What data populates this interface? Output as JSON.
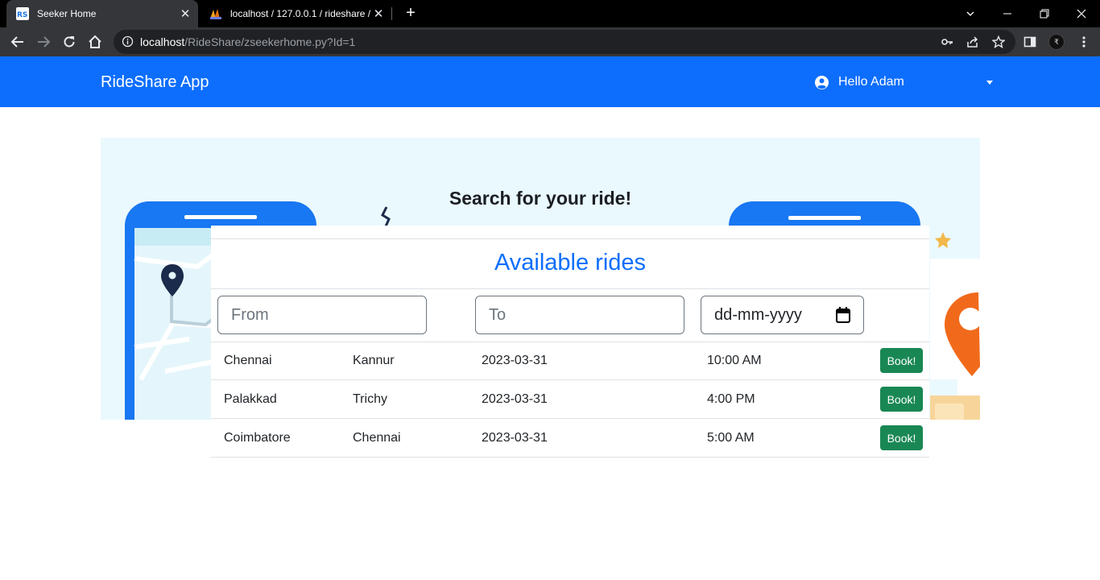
{
  "browser": {
    "tabs": [
      {
        "title": "Seeker Home",
        "favicon": "RS"
      },
      {
        "title": "localhost / 127.0.0.1 / rideshare /",
        "favicon": "phpmyadmin-icon"
      }
    ],
    "url_host": "localhost",
    "url_path": "/RideShare/zseekerhome.py?Id=1"
  },
  "navbar": {
    "brand": "RideShare App",
    "user_greeting": "Hello Adam"
  },
  "hero": {
    "title": "Search for your ride!"
  },
  "rides": {
    "title": "Available rides",
    "from_placeholder": "From",
    "to_placeholder": "To",
    "date_placeholder": "dd-mm-yyyy",
    "book_label": "Book!",
    "rows": [
      {
        "from": "Chennai",
        "to": "Kannur",
        "date": "2023-03-31",
        "time": "10:00 AM"
      },
      {
        "from": "Palakkad",
        "to": "Trichy",
        "date": "2023-03-31",
        "time": "4:00 PM"
      },
      {
        "from": "Coimbatore",
        "to": "Chennai",
        "date": "2023-03-31",
        "time": "5:00 AM"
      }
    ]
  },
  "colors": {
    "primary": "#0d6efd",
    "success": "#198754",
    "hero_bg": "#eaf9fd"
  }
}
